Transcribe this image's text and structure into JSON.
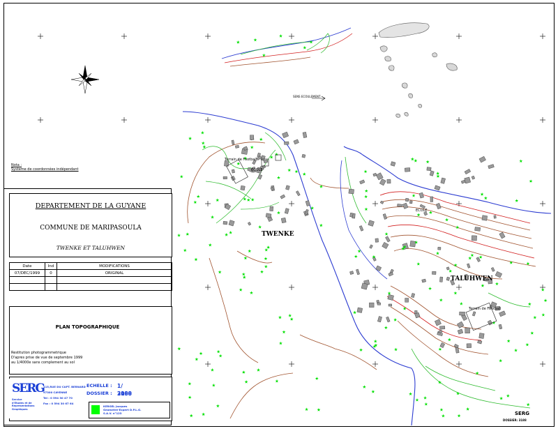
{
  "note": {
    "label": "Nota :",
    "text": "Systeme de coordonnées indépendant"
  },
  "cartouche": {
    "departement": "DEPARTEMENT DE LA GUYANE",
    "commune": "COMMUNE DE MARIPASOULA",
    "villages": "TWENKE ET TALUHWEN",
    "modifications": {
      "headers": [
        "Date",
        "Ind",
        "MODIFICATIONS"
      ],
      "rows": [
        [
          "07/DEC/1999",
          "0",
          "ORIGINAL"
        ]
      ]
    },
    "plan_title": "PLAN TOPOGRAPHIQUE",
    "restitution": [
      "Restitution photogrammetrique",
      "D'apres prise de vue de septembre 1999",
      "au 1/4000e sans complement au sol"
    ],
    "logo": {
      "letters": "SERG",
      "subtitle": [
        "Service",
        "d'Etudes et de",
        "Representations",
        "Graphiques"
      ]
    },
    "contact": [
      "115,RUE DU CAPT. BERNARD",
      "97300 CAYENNE",
      "Tel : 0 594 30 47 70",
      "Fax : 0 594 30 67 64"
    ],
    "echelle": {
      "label": "ECHELLE :",
      "value": "1/ 2000"
    },
    "dossier": {
      "label": "DOSSIER :",
      "value": "3188"
    },
    "geometre": [
      "KERGEL Jacques",
      "Geometre-Expert D.P.L.G.",
      "S.A.V. n°123"
    ]
  },
  "map_labels": {
    "twenke": "TWENKE",
    "taluhwen": "TALUHWEN",
    "terrain_foot_1": "Terrain de Football",
    "terrain_foot_2": "Terrain de Football",
    "ecole_1": "ECOLE",
    "ecole_2": "ECOLE",
    "flow": "SENS ECOULEMENT"
  },
  "footer": {
    "serg": "SERG",
    "dossier": "DOSSIER: 3188"
  },
  "colors": {
    "contour_brown": "#a0522d",
    "contour_red": "#d21e1e",
    "river_blue": "#2b3bd1",
    "vegetation_green": "#00e000",
    "path_green": "#2dbb2d",
    "serg_blue": "#1a3fd6"
  }
}
